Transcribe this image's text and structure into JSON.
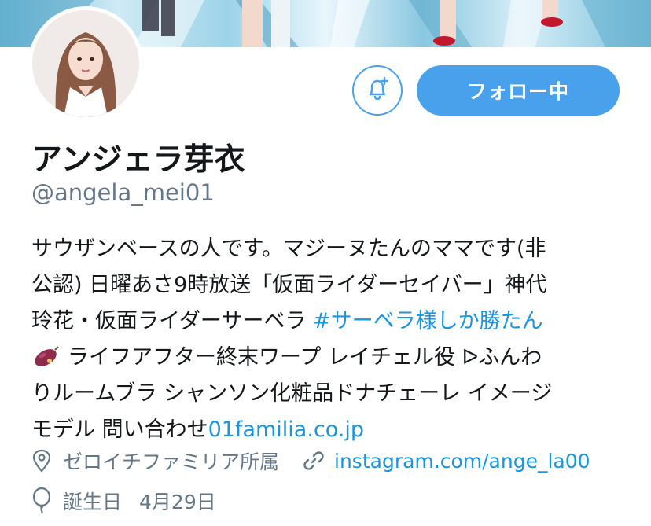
{
  "profile": {
    "display_name": "アンジェラ芽衣",
    "handle": "@angela_mei01",
    "follow_label": "フォロー中",
    "bio_lines": {
      "l1": "サウザンベースの人です。マジーヌたんのママです(非",
      "l2": "公認) 日曜あさ9時放送「仮面ライダーセイバー」神代",
      "l3_text": "玲花・仮面ライダーサーベラ ",
      "l3_hashtag": "#サーベラ様しか勝たん",
      "l4": "ライフアフター終末ワープ レイチェル役 ᐅふんわ",
      "l5": "りルームブラ シャンソン化粧品ドナチェーレ イメージ",
      "l6_text": "モデル 問い合わせ",
      "l6_link": "01familia.co.jp"
    },
    "location": "ゼロイチファミリア所属",
    "website": "instagram.com/ange_la00",
    "birthday_label": "誕生日",
    "birthday_value": "4月29日"
  },
  "colors": {
    "accent": "#4aa1eb",
    "link": "#1b95e0",
    "secondary_text": "#657786"
  }
}
